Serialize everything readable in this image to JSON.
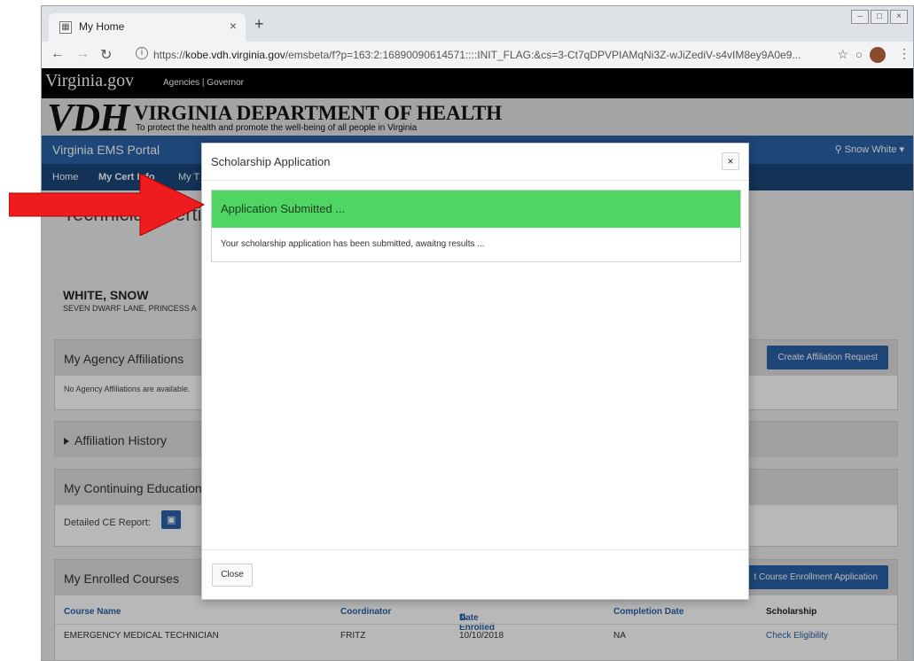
{
  "browser": {
    "tab_title": "My Home",
    "tab_close": "×",
    "new_tab": "+",
    "url_prefix": "https://",
    "url_host": "kobe.vdh.virginia.gov",
    "url_path": "/emsbeta/f?p=163:2:16890090614571::::INIT_FLAG:&cs=3-Ct7qDPVPIAMqNi3Z-wJiZediV-s4vIM8ey9A0e9...",
    "window_controls": [
      "–",
      "□",
      "×"
    ]
  },
  "site": {
    "va_logo": "Virginia.gov",
    "va_links": "Agencies | Governor",
    "vdh_logo": "VDH",
    "vdh_title": "VIRGINIA DEPARTMENT OF HEALTH",
    "vdh_tagline": "To protect the health and promote the well-being of all people in Virginia",
    "portal_title": "Virginia EMS Portal",
    "user": "Snow White ▾",
    "nav": [
      "Home",
      "My Cert Info",
      "My T"
    ]
  },
  "profile": {
    "page_title": "Technician Certi",
    "name": "WHITE, SNOW",
    "address": "SEVEN DWARF LANE, PRINCESS A"
  },
  "panels": {
    "affiliations": {
      "title": "My Agency Affiliations",
      "empty": "No Agency Affiliations are available.",
      "button": "Create Affiliation Request"
    },
    "history": {
      "title": "Affiliation History"
    },
    "ce": {
      "title": "My Continuing Education",
      "report_label": "Detailed CE Report:"
    },
    "courses": {
      "title": "My Enrolled Courses",
      "button": "t Course Enrollment Application",
      "columns": [
        "Course Name",
        "Coordinator",
        "Date Enrolled",
        "Completion Date",
        "Scholarship"
      ],
      "sort_indicator": "⇅",
      "rows": [
        [
          "EMERGENCY MEDICAL TECHNICIAN",
          "FRITZ",
          "10/10/2018",
          "NA",
          "Check Eligibility"
        ]
      ]
    }
  },
  "modal": {
    "title": "Scholarship Application",
    "close_x": "×",
    "alert_title": "Application Submitted ...",
    "alert_message": "Your scholarship application has been submitted, awaitng results ...",
    "close_button": "Close"
  },
  "colors": {
    "portal_blue": "#2a62a8",
    "nav_dark_blue": "#1b467a",
    "success_green": "#4fd562",
    "arrow_red": "#ee1c1c"
  }
}
